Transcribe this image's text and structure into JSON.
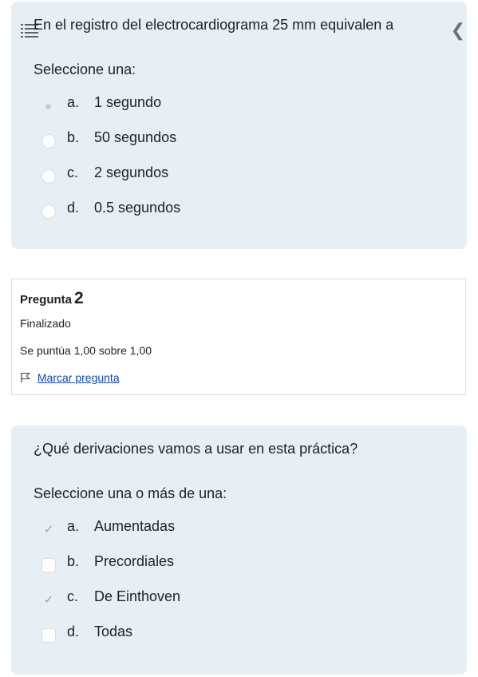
{
  "question1": {
    "text": "En el registro del electrocardiograma 25 mm equivalen a",
    "prompt": "Seleccione una:",
    "options": [
      {
        "letter": "a.",
        "text": "1 segundo",
        "selected": true
      },
      {
        "letter": "b.",
        "text": "50 segundos",
        "selected": false
      },
      {
        "letter": "c.",
        "text": "2 segundos",
        "selected": false
      },
      {
        "letter": "d.",
        "text": "0.5 segundos",
        "selected": false
      }
    ],
    "icons": {
      "left": "list-icon",
      "right": "chevron-left-icon"
    }
  },
  "question2_info": {
    "label": "Pregunta",
    "number": "2",
    "state": "Finalizado",
    "grade": "Se puntúa 1,00 sobre 1,00",
    "flag_label": "Marcar pregunta",
    "flag_icon": "flag-icon"
  },
  "question2": {
    "text": "¿Qué derivaciones vamos a usar en esta práctica?",
    "prompt": "Seleccione una o más de una:",
    "options": [
      {
        "letter": "a.",
        "text": "Aumentadas",
        "checked": true
      },
      {
        "letter": "b.",
        "text": "Precordiales",
        "checked": false
      },
      {
        "letter": "c.",
        "text": "De Einthoven",
        "checked": true
      },
      {
        "letter": "d.",
        "text": "Todas",
        "checked": false
      }
    ]
  },
  "colors": {
    "card_background": "#e7eff5",
    "link": "#0f47ad",
    "text": "#1d2125"
  }
}
